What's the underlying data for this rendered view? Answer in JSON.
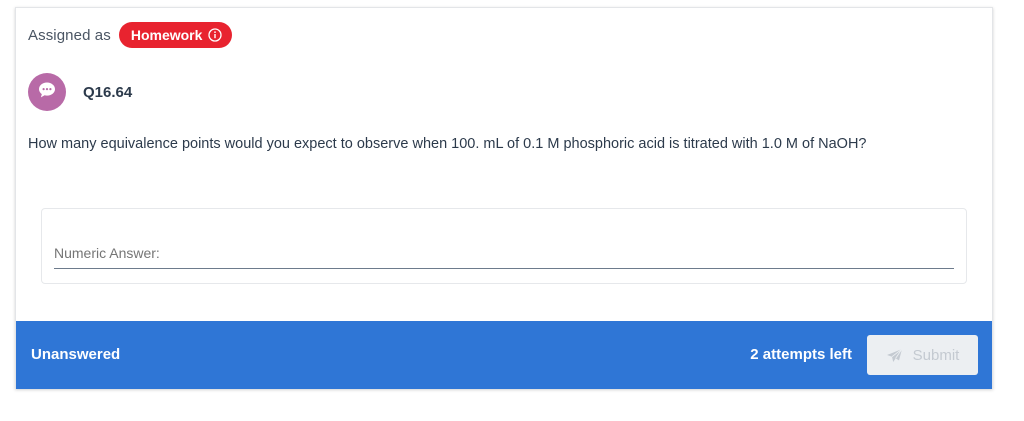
{
  "assignment": {
    "assigned_label": "Assigned as",
    "badge_label": "Homework",
    "badge_color": "#e8232f",
    "info_icon": "info-circle-icon"
  },
  "question": {
    "avatar_icon": "chat-bubble-icon",
    "avatar_color": "#b86aa7",
    "number": "Q16.64",
    "text": "How many equivalence points would you expect to observe when 100. mL of 0.1 M phosphoric acid is titrated with 1.0 M of NaOH?"
  },
  "answer": {
    "label": "Numeric Answer:",
    "value": ""
  },
  "footer": {
    "bar_color": "#2f76d6",
    "status": "Unanswered",
    "attempts": "2 attempts left",
    "submit_label": "Submit",
    "submit_icon": "paper-plane-icon"
  }
}
